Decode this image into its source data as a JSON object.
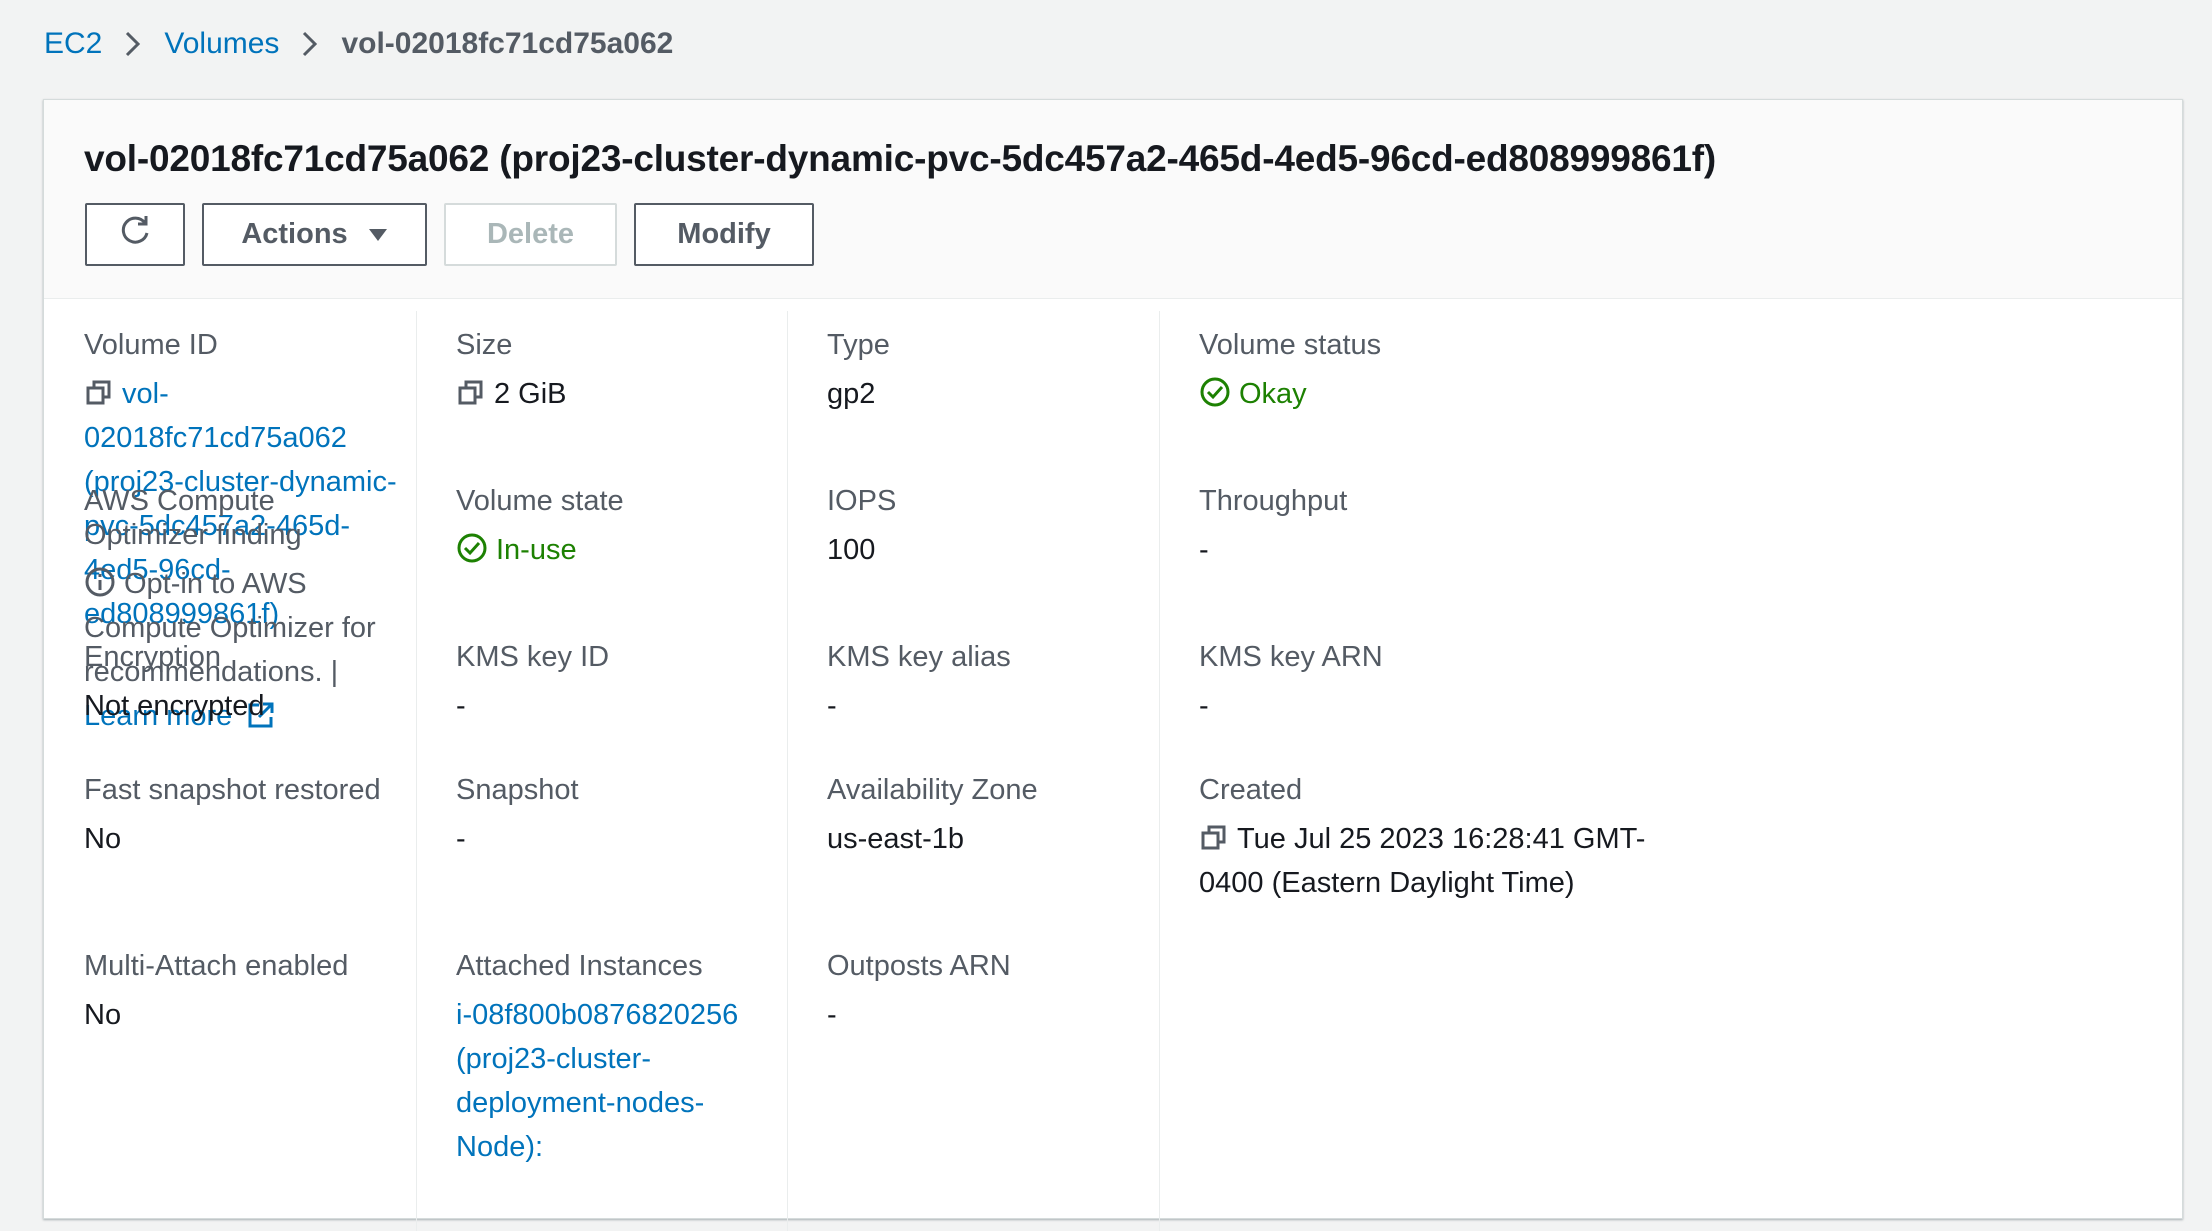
{
  "breadcrumb": {
    "items": [
      "EC2",
      "Volumes"
    ],
    "current": "vol-02018fc71cd75a062"
  },
  "header": {
    "title": "vol-02018fc71cd75a062 (proj23-cluster-dynamic-pvc-5dc457a2-465d-4ed5-96cd-ed808999861f)",
    "actions_label": "Actions",
    "delete_label": "Delete",
    "modify_label": "Modify"
  },
  "details": {
    "volume_id": {
      "label": "Volume ID",
      "value": "vol-02018fc71cd75a062 (proj23-cluster-dynamic-pvc-5dc457a2-465d-4ed5-96cd-ed808999861f)"
    },
    "size": {
      "label": "Size",
      "value": "2 GiB"
    },
    "type": {
      "label": "Type",
      "value": "gp2"
    },
    "volume_status": {
      "label": "Volume status",
      "value": "Okay"
    },
    "optimizer": {
      "label": "AWS Compute Optimizer finding",
      "value": "Opt-in to AWS Compute Optimizer for recommendations. |",
      "learn_more": "Learn more"
    },
    "volume_state": {
      "label": "Volume state",
      "value": "In-use"
    },
    "iops": {
      "label": "IOPS",
      "value": "100"
    },
    "throughput": {
      "label": "Throughput",
      "value": "-"
    },
    "encryption": {
      "label": "Encryption",
      "value": "Not encrypted"
    },
    "kms_key_id": {
      "label": "KMS key ID",
      "value": "-"
    },
    "kms_key_alias": {
      "label": "KMS key alias",
      "value": "-"
    },
    "kms_key_arn": {
      "label": "KMS key ARN",
      "value": "-"
    },
    "fast_snapshot": {
      "label": "Fast snapshot restored",
      "value": "No"
    },
    "snapshot": {
      "label": "Snapshot",
      "value": "-"
    },
    "availability_zone": {
      "label": "Availability Zone",
      "value": "us-east-1b"
    },
    "created": {
      "label": "Created",
      "value": "Tue Jul 25 2023 16:28:41 GMT-0400 (Eastern Daylight Time)"
    },
    "multi_attach": {
      "label": "Multi-Attach enabled",
      "value": "No"
    },
    "attached_instances": {
      "label": "Attached Instances",
      "value": "i-08f800b0876820256 (proj23-cluster-deployment-nodes-Node):"
    },
    "outposts_arn": {
      "label": "Outposts ARN",
      "value": "-"
    }
  },
  "colors": {
    "link": "#0073bb",
    "success": "#1d8102",
    "label": "#545b64",
    "panel_header_bg": "#fafafa"
  },
  "icons": [
    "chevron-right-icon",
    "refresh-icon",
    "caret-down-icon",
    "copy-icon",
    "check-circle-icon",
    "info-icon",
    "external-link-icon"
  ]
}
